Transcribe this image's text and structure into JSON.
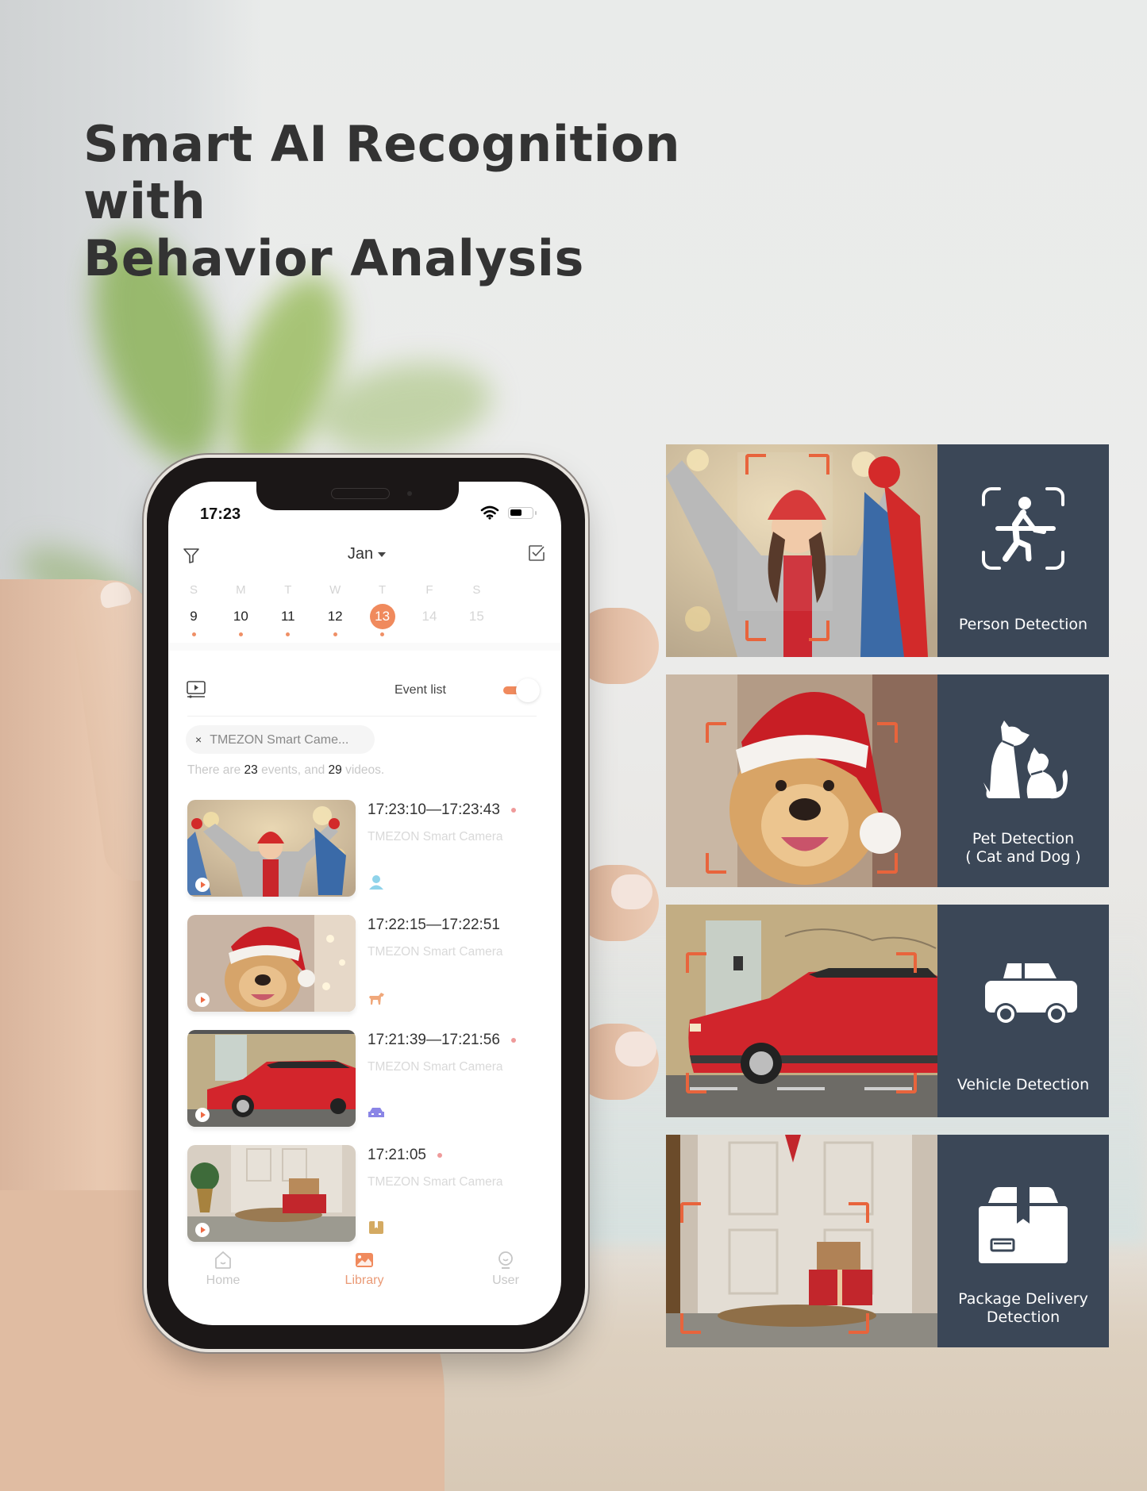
{
  "headline": {
    "line1": "Smart AI Recognition with",
    "line2": "Behavior Analysis"
  },
  "phone": {
    "status_bar": {
      "time": "17:23",
      "wifi_icon": "wifi-icon",
      "battery_icon": "battery-icon"
    },
    "header": {
      "filter_icon": "filter-icon",
      "month": "Jan",
      "select_icon": "checkbox-select-icon"
    },
    "calendar": {
      "days": [
        {
          "letter": "S",
          "date": "9",
          "has_events": true,
          "state": "past"
        },
        {
          "letter": "M",
          "date": "10",
          "has_events": true,
          "state": "past"
        },
        {
          "letter": "T",
          "date": "11",
          "has_events": true,
          "state": "past"
        },
        {
          "letter": "W",
          "date": "12",
          "has_events": true,
          "state": "past"
        },
        {
          "letter": "T",
          "date": "13",
          "has_events": true,
          "state": "selected"
        },
        {
          "letter": "F",
          "date": "14",
          "has_events": false,
          "state": "future"
        },
        {
          "letter": "S",
          "date": "15",
          "has_events": false,
          "state": "future"
        }
      ]
    },
    "list_controls": {
      "playback_icon": "playback-icon",
      "event_list_label": "Event list",
      "event_list_toggle_on": true
    },
    "device_filter_chip": {
      "close": "×",
      "label": "TMEZON Smart Came..."
    },
    "summary": {
      "prefix": "There are ",
      "events": "23",
      "middle": " events, and ",
      "videos": "29",
      "suffix": " videos."
    },
    "events": [
      {
        "time": "17:23:10—17:23:43",
        "camera": "TMEZON Smart Camera",
        "type": "person",
        "type_icon": "person-icon",
        "unread": true
      },
      {
        "time": "17:22:15—17:22:51",
        "camera": "TMEZON Smart Camera",
        "type": "pet",
        "type_icon": "dog-icon",
        "unread": false
      },
      {
        "time": "17:21:39—17:21:56",
        "camera": "TMEZON Smart Camera",
        "type": "vehicle",
        "type_icon": "car-icon",
        "unread": true
      },
      {
        "time": "17:21:05",
        "camera": "TMEZON Smart Camera",
        "type": "package",
        "type_icon": "package-icon",
        "unread": true
      }
    ],
    "tabbar": [
      {
        "label": "Home",
        "icon": "home-icon",
        "active": false
      },
      {
        "label": "Library",
        "icon": "library-icon",
        "active": true
      },
      {
        "label": "User",
        "icon": "user-icon",
        "active": false
      }
    ]
  },
  "features": [
    {
      "label": "Person Detection",
      "icon": "person-detection-icon"
    },
    {
      "label": "Pet Detection",
      "sublabel": "( Cat and Dog )",
      "icon": "pet-detection-icon"
    },
    {
      "label": "Vehicle Detection",
      "icon": "vehicle-detection-icon"
    },
    {
      "label": "Package Delivery",
      "sublabel": "Detection",
      "icon": "package-detection-icon"
    }
  ],
  "colors": {
    "accent": "#f08a5d",
    "card_bg": "#3b4757",
    "frame_corner": "#e8643c",
    "title": "#333333"
  }
}
